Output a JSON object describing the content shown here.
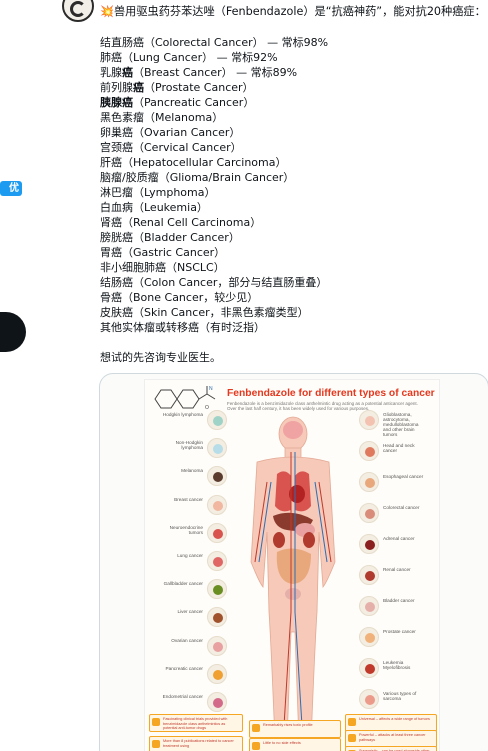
{
  "sidebar": {
    "badge_label": "优惠"
  },
  "post": {
    "headline_emoji": "💥",
    "headline": "兽用驱虫药芬苯达唑（Fenbendazole）是“抗癌神药”，能对抗20种癌症：",
    "cancer_list": [
      {
        "pre": "",
        "strong": "",
        "text": "结直肠癌（Colorectal Cancer） — 常标98%"
      },
      {
        "pre": "",
        "strong": "",
        "text": "肺癌（Lung Cancer） — 常标92%"
      },
      {
        "pre": "乳腺",
        "strong": "癌",
        "text": "（Breast Cancer） — 常标89%"
      },
      {
        "pre": "前列腺",
        "strong": "癌",
        "text": "（Prostate Cancer）"
      },
      {
        "pre": "",
        "strong": "胰腺癌",
        "text": "（Pancreatic Cancer）"
      },
      {
        "pre": "",
        "strong": "",
        "text": "黑色素瘤（Melanoma）"
      },
      {
        "pre": "",
        "strong": "",
        "text": "卵巢癌（Ovarian Cancer）"
      },
      {
        "pre": "",
        "strong": "",
        "text": "宫颈癌（Cervical Cancer）"
      },
      {
        "pre": "",
        "strong": "",
        "text": "肝癌（Hepatocellular Carcinoma）"
      },
      {
        "pre": "",
        "strong": "",
        "text": "脑瘤/胶质瘤（Glioma/Brain Cancer）"
      },
      {
        "pre": "",
        "strong": "",
        "text": "淋巴瘤（Lymphoma）"
      },
      {
        "pre": "",
        "strong": "",
        "text": "白血病（Leukemia）"
      },
      {
        "pre": "",
        "strong": "",
        "text": "肾癌（Renal Cell Carcinoma）"
      },
      {
        "pre": "",
        "strong": "",
        "text": "膀胱癌（Bladder Cancer）"
      },
      {
        "pre": "",
        "strong": "",
        "text": "胃癌（Gastric Cancer）"
      },
      {
        "pre": "",
        "strong": "",
        "text": "非小细胞肺癌（NSCLC）"
      },
      {
        "pre": "",
        "strong": "",
        "text": "结肠癌（Colon Cancer，部分与结直肠重叠）"
      },
      {
        "pre": "",
        "strong": "",
        "text": "骨癌（Bone Cancer，较少见）"
      },
      {
        "pre": "",
        "strong": "",
        "text": "皮肤癌（Skin Cancer，非黑色素瘤类型）"
      },
      {
        "pre": "",
        "strong": "",
        "text": "其他实体瘤或转移癌（有时泛指）"
      }
    ],
    "closing": "想试的先咨询专业医生。"
  },
  "media": {
    "poster_title": "Fenbendazole for different types of cancer",
    "poster_subtitle": "Fenbendazole is a benzimidazole class anthelmintic drug acting as a potential anticancer agent. Over the last half century, it has been widely used for various purposes.",
    "left_organs": [
      {
        "label": "Hodgkin lymphoma",
        "color": "#9fd3c7"
      },
      {
        "label": "Non-Hodgkin lymphoma",
        "color": "#b7dde8"
      },
      {
        "label": "Melanoma",
        "color": "#5a3b2e"
      },
      {
        "label": "Breast cancer",
        "color": "#f1b7a0"
      },
      {
        "label": "Neuroendocrine tumors",
        "color": "#d9534f"
      },
      {
        "label": "Lung cancer",
        "color": "#e06666"
      },
      {
        "label": "Gallbladder cancer",
        "color": "#6b8e23"
      },
      {
        "label": "Liver cancer",
        "color": "#a0522d"
      },
      {
        "label": "Ovarian cancer",
        "color": "#e8a0a0"
      },
      {
        "label": "Pancreatic cancer",
        "color": "#f0a030"
      },
      {
        "label": "Endometrial cancer",
        "color": "#d46a8a"
      }
    ],
    "right_organs": [
      {
        "label": "Glioblastoma, astrocytoma, medulloblastoma and other brain tumors",
        "color": "#f4c2b0"
      },
      {
        "label": "Head and neck cancer",
        "color": "#e07a5f"
      },
      {
        "label": "Esophageal cancer",
        "color": "#e8a87c"
      },
      {
        "label": "Colorectal cancer",
        "color": "#d98c7a"
      },
      {
        "label": "Adrenal cancer",
        "color": "#8b1e1e"
      },
      {
        "label": "Renal cancer",
        "color": "#b03a2e"
      },
      {
        "label": "Bladder cancer",
        "color": "#e6b0aa"
      },
      {
        "label": "Prostate cancer",
        "color": "#f0b27a"
      },
      {
        "label": "Leukemia Myelofibrosis",
        "color": "#c0392b"
      },
      {
        "label": "Various types of sarcoma",
        "color": "#ec9b8a"
      }
    ],
    "notes_left": [
      "Fascinating clinical trials provided with benzimidazole class anthelmintics as potential anti-tumor drugs",
      "More than 8 publications related to cancer treatment using"
    ],
    "notes_center": [
      "Remarkably rises toxic profile",
      "Little to no side effects"
    ],
    "notes_right": [
      "Universal – affects a wide range of tumors",
      "Powerful – attacks at least three cancer pathways",
      "Synergistic – can be used alongside other cancer treatments"
    ]
  }
}
